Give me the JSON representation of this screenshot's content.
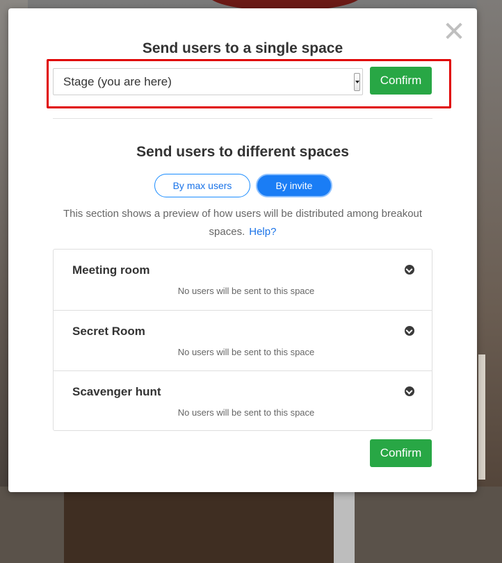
{
  "modal": {
    "close_glyph": "✕",
    "single": {
      "title": "Send users to a single space",
      "selected_space": "Stage (you are here)",
      "confirm_label": "Confirm"
    },
    "multi": {
      "title": "Send users to different spaces",
      "toggle_max_users": "By max users",
      "toggle_invite": "By invite",
      "active_toggle": "By invite",
      "description": "This section shows a preview of how users will be distributed among breakout spaces.",
      "help_label": "Help?",
      "spaces": [
        {
          "name": "Meeting room",
          "status": "No users will be sent to this space"
        },
        {
          "name": "Secret Room",
          "status": "No users will be sent to this space"
        },
        {
          "name": "Scavenger hunt",
          "status": "No users will be sent to this space"
        }
      ],
      "confirm_label": "Confirm"
    }
  },
  "colors": {
    "confirm_green": "#28a745",
    "toggle_active_blue": "#1a7df5",
    "link_blue": "#1a73e8",
    "highlight_red": "#e00000"
  },
  "icons": {
    "close": "close-icon",
    "expand": "chevron-down-circle-icon"
  }
}
